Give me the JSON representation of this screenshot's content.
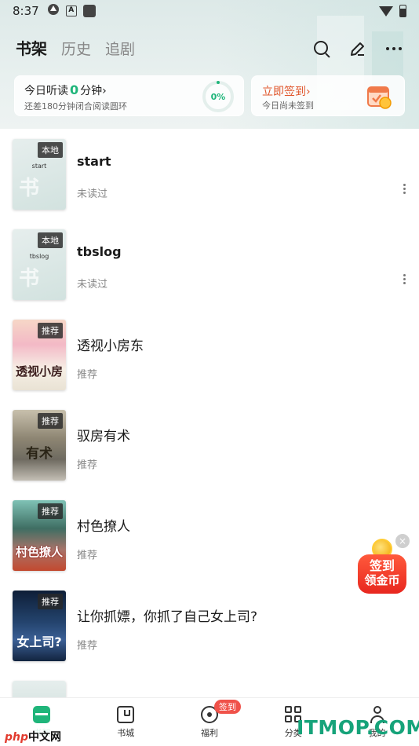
{
  "status_bar": {
    "time": "8:37",
    "a_label": "A"
  },
  "header": {
    "tabs": [
      {
        "label": "书架",
        "active": true
      },
      {
        "label": "历史",
        "active": false
      },
      {
        "label": "追剧",
        "active": false
      }
    ],
    "icons": [
      "search-icon",
      "edit-icon",
      "more-icon"
    ]
  },
  "listen_card": {
    "prefix": "今日听读",
    "minutes": "0",
    "suffix": "分钟",
    "chevron": "›",
    "subtitle": "还差180分钟闭合阅读圆环",
    "progress": "0%"
  },
  "signin_card": {
    "title": "立即签到",
    "chevron": "›",
    "subtitle": "今日尚未签到"
  },
  "books": [
    {
      "title": "start",
      "subtitle": "未读过",
      "tag": "本地",
      "cover_text": "start",
      "has_more": true
    },
    {
      "title": "tbslog",
      "subtitle": "未读过",
      "tag": "本地",
      "cover_text": "tbslog",
      "has_more": true
    },
    {
      "title": "透视小房东",
      "subtitle": "推荐",
      "tag": "推荐",
      "cover_text": "透视小房",
      "has_more": false
    },
    {
      "title": "驭房有术",
      "subtitle": "推荐",
      "tag": "推荐",
      "cover_text": "有术",
      "has_more": false
    },
    {
      "title": "村色撩人",
      "subtitle": "推荐",
      "tag": "推荐",
      "cover_text": "村色撩人",
      "has_more": false
    },
    {
      "title": "让你抓嫖，你抓了自己女上司?",
      "subtitle": "推荐",
      "tag": "推荐",
      "cover_text": "女上司?",
      "has_more": false
    }
  ],
  "float_coin": {
    "line1": "签到",
    "line2": "领金币",
    "close": "×"
  },
  "bottom_nav": [
    {
      "label": "书架",
      "icon": "bookshelf-icon",
      "active": true
    },
    {
      "label": "书城",
      "icon": "bookstore-icon",
      "active": false
    },
    {
      "label": "福利",
      "icon": "welfare-icon",
      "active": false,
      "badge": "签到"
    },
    {
      "label": "分类",
      "icon": "category-icon",
      "active": false
    },
    {
      "label": "我的",
      "icon": "profile-icon",
      "active": false
    }
  ],
  "watermarks": {
    "left_a": "php",
    "left_b": "中文网",
    "right": "ITMOP.COM"
  },
  "colors": {
    "accent": "#1fb57a",
    "signin": "#e0562b",
    "badge": "#f0524a"
  }
}
